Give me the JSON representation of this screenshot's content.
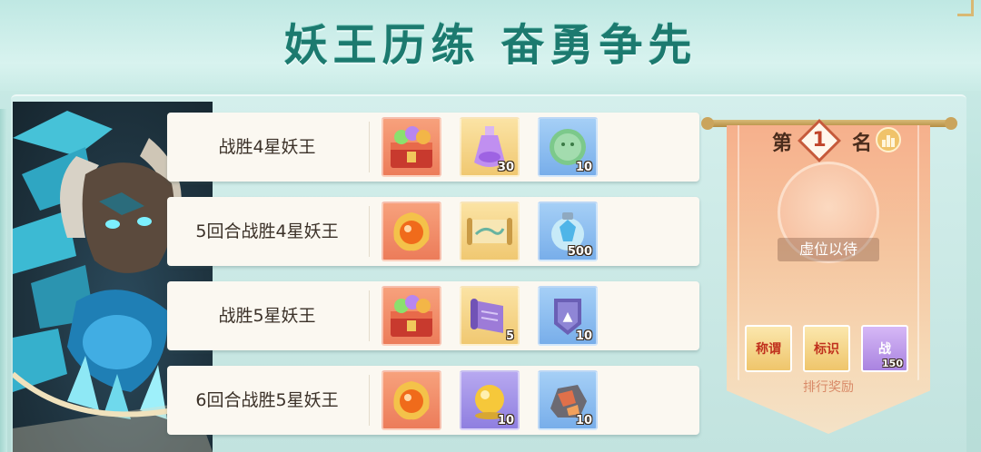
{
  "title": "妖王历练 奋勇争先",
  "tasks": [
    {
      "label": "战胜4星妖王",
      "rewards": [
        {
          "icon": "treasure-chest-icon",
          "bg": "red",
          "count": ""
        },
        {
          "icon": "potion-bottle-icon",
          "bg": "gold",
          "count": "30"
        },
        {
          "icon": "jade-coin-icon",
          "bg": "blue",
          "count": "10"
        }
      ]
    },
    {
      "label": "5回合战胜4星妖王",
      "rewards": [
        {
          "icon": "fire-orb-icon",
          "bg": "red",
          "count": ""
        },
        {
          "icon": "scroll-map-icon",
          "bg": "gold",
          "count": ""
        },
        {
          "icon": "crystal-pouch-icon",
          "bg": "blue",
          "count": "500"
        }
      ]
    },
    {
      "label": "战胜5星妖王",
      "rewards": [
        {
          "icon": "treasure-chest-icon",
          "bg": "red",
          "count": ""
        },
        {
          "icon": "purple-scroll-icon",
          "bg": "gold",
          "count": "5"
        },
        {
          "icon": "badge-token-icon",
          "bg": "blue",
          "count": "10"
        }
      ]
    },
    {
      "label": "6回合战胜5星妖王",
      "rewards": [
        {
          "icon": "fire-orb-icon",
          "bg": "red",
          "count": ""
        },
        {
          "icon": "gold-orb-icon",
          "bg": "gold",
          "count": "10"
        },
        {
          "icon": "ore-stone-icon",
          "bg": "blue",
          "count": "10"
        }
      ]
    }
  ],
  "ranking": {
    "prefix": "第",
    "rank": "1",
    "suffix": "名",
    "vacant_text": "虚位以待",
    "rewards": [
      {
        "icon": "title-plaque-icon",
        "text": "称谓",
        "bg": "gold",
        "count": ""
      },
      {
        "icon": "mark-plaque-icon",
        "text": "标识",
        "bg": "gold",
        "count": ""
      },
      {
        "icon": "battle-token-icon",
        "text": "战",
        "bg": "purple",
        "count": "150"
      }
    ],
    "rewards_label": "排行奖励"
  },
  "colors": {
    "title": "#1c7a6f",
    "banner": "#f6b08c",
    "rank_accent": "#c0442a"
  }
}
